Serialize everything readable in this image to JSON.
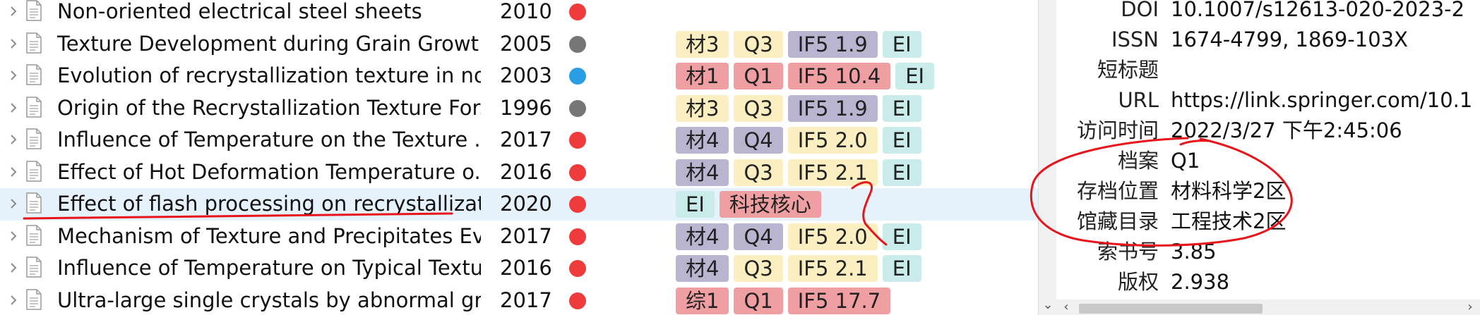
{
  "items": [
    {
      "title": "Non-oriented electrical steel sheets",
      "year": "2010",
      "dot": "#ef3b3b",
      "tags": []
    },
    {
      "title": "Texture Development during Grain Growt...",
      "year": "2005",
      "dot": "#767676",
      "tags": [
        {
          "text": "材3",
          "color": "#fbeec1"
        },
        {
          "text": "Q3",
          "color": "#fbeec1"
        },
        {
          "text": "IF5 1.9",
          "color": "#b9b4cf"
        },
        {
          "text": "EI",
          "color": "#c9ecea"
        }
      ]
    },
    {
      "title": "Evolution of recrystallization texture in no...",
      "year": "2003",
      "dot": "#2a9ee4",
      "tags": [
        {
          "text": "材1",
          "color": "#ef9fa1"
        },
        {
          "text": "Q1",
          "color": "#ef9fa1"
        },
        {
          "text": "IF5 10.4",
          "color": "#ef9fa1"
        },
        {
          "text": "EI",
          "color": "#c9ecea"
        }
      ]
    },
    {
      "title": "Origin of the Recrystallization Texture For...",
      "year": "1996",
      "dot": "#767676",
      "tags": [
        {
          "text": "材3",
          "color": "#fbeec1"
        },
        {
          "text": "Q3",
          "color": "#fbeec1"
        },
        {
          "text": "IF5 1.9",
          "color": "#b9b4cf"
        },
        {
          "text": "EI",
          "color": "#c9ecea"
        }
      ]
    },
    {
      "title": "Influence of Temperature on the Texture ...",
      "year": "2017",
      "dot": "#ef3b3b",
      "tags": [
        {
          "text": "材4",
          "color": "#b9b4cf"
        },
        {
          "text": "Q4",
          "color": "#b9b4cf"
        },
        {
          "text": "IF5 2.0",
          "color": "#fbeec1"
        },
        {
          "text": "EI",
          "color": "#c9ecea"
        }
      ]
    },
    {
      "title": "Effect of Hot Deformation Temperature o...",
      "year": "2016",
      "dot": "#ef3b3b",
      "tags": [
        {
          "text": "材4",
          "color": "#b9b4cf"
        },
        {
          "text": "Q3",
          "color": "#fbeec1"
        },
        {
          "text": "IF5 2.1",
          "color": "#fbeec1"
        },
        {
          "text": "EI",
          "color": "#c9ecea"
        }
      ]
    },
    {
      "title": "Effect of flash processing on recrystallizati...",
      "year": "2020",
      "dot": "#ef3b3b",
      "selected": true,
      "tags": [
        {
          "text": "EI",
          "color": "#c9ecea"
        },
        {
          "text": "科技核心",
          "color": "#ef9fa1"
        }
      ]
    },
    {
      "title": "Mechanism of Texture and Precipitates Ev...",
      "year": "2017",
      "dot": "#ef3b3b",
      "tags": [
        {
          "text": "材4",
          "color": "#b9b4cf"
        },
        {
          "text": "Q4",
          "color": "#b9b4cf"
        },
        {
          "text": "IF5 2.0",
          "color": "#fbeec1"
        },
        {
          "text": "EI",
          "color": "#c9ecea"
        }
      ]
    },
    {
      "title": "Influence of Temperature on Typical Textu...",
      "year": "2016",
      "dot": "#ef3b3b",
      "tags": [
        {
          "text": "材4",
          "color": "#b9b4cf"
        },
        {
          "text": "Q3",
          "color": "#fbeec1"
        },
        {
          "text": "IF5 2.1",
          "color": "#fbeec1"
        },
        {
          "text": "EI",
          "color": "#c9ecea"
        }
      ]
    },
    {
      "title": "Ultra-large single crystals by abnormal gra...",
      "year": "2017",
      "dot": "#ef3b3b",
      "tags": [
        {
          "text": "综1",
          "color": "#ef9fa1"
        },
        {
          "text": "Q1",
          "color": "#ef9fa1"
        },
        {
          "text": "IF5 17.7",
          "color": "#ef9fa1"
        }
      ]
    }
  ],
  "info": [
    {
      "label": "DOI",
      "value": "10.1007/s12613-020-2023-2"
    },
    {
      "label": "ISSN",
      "value": "1674-4799, 1869-103X"
    },
    {
      "label": "短标题",
      "value": ""
    },
    {
      "label": "URL",
      "value": "https://link.springer.com/10.1"
    },
    {
      "label": "访问时间",
      "value": "2022/3/27 下午2:45:06"
    },
    {
      "label": "档案",
      "value": "Q1"
    },
    {
      "label": "存档位置",
      "value": "材料科学2区"
    },
    {
      "label": "馆藏目录",
      "value": "工程技术2区"
    },
    {
      "label": "索书号",
      "value": "3.85"
    },
    {
      "label": "版权",
      "value": "2.938"
    }
  ],
  "colors": {
    "selected_row": "#e5f1fb",
    "annotation_red": "#e8141b"
  },
  "icons": {
    "expand": "chevron-right-icon",
    "item": "document-icon",
    "scroll_down": "chevron-down-icon",
    "scroll_left": "chevron-left-icon",
    "scroll_right": "chevron-right-icon"
  }
}
